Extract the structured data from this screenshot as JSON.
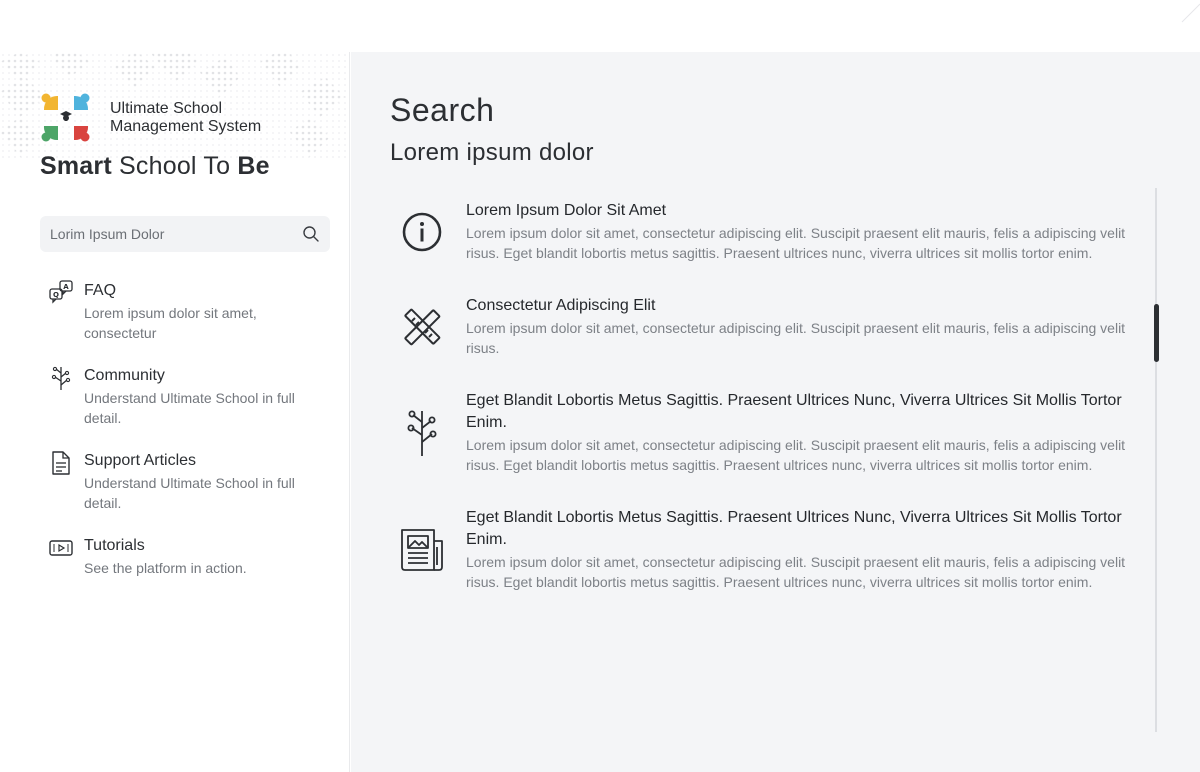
{
  "brand": {
    "name_line1": "Ultimate School",
    "name_line2": "Management System",
    "tagline_bold1": "Smart",
    "tagline_light": "School To",
    "tagline_bold2": "Be"
  },
  "sidebar": {
    "search": {
      "placeholder": "Lorim Ipsum Dolor"
    },
    "items": [
      {
        "title": "FAQ",
        "desc": "Lorem ipsum dolor sit amet, consectetur",
        "icon": "faq-icon"
      },
      {
        "title": "Community",
        "desc": "Understand Ultimate School in full detail.",
        "icon": "community-icon"
      },
      {
        "title": "Support Articles",
        "desc": "Understand Ultimate School in full detail.",
        "icon": "document-icon"
      },
      {
        "title": "Tutorials",
        "desc": "See the platform in action.",
        "icon": "video-icon"
      }
    ]
  },
  "main": {
    "title": "Search",
    "subtitle": "Lorem ipsum dolor",
    "results": [
      {
        "title": "Lorem Ipsum Dolor Sit Amet",
        "desc": "Lorem ipsum dolor sit amet, consectetur adipiscing elit. Suscipit praesent elit mauris, felis a adipiscing velit risus. Eget blandit lobortis metus sagittis. Praesent ultrices nunc, viverra ultrices sit mollis tortor enim.",
        "icon": "info-icon"
      },
      {
        "title": "Consectetur Adipiscing Elit",
        "desc": "Lorem ipsum dolor sit amet, consectetur adipiscing elit. Suscipit praesent elit mauris, felis a adipiscing velit risus.",
        "icon": "design-tools-icon"
      },
      {
        "title": "Eget Blandit Lobortis Metus Sagittis. Praesent Ultrices Nunc, Viverra Ultrices Sit Mollis Tortor Enim.",
        "desc": "Lorem ipsum dolor sit amet, consectetur adipiscing elit. Suscipit praesent elit mauris, felis a adipiscing velit risus. Eget blandit lobortis metus sagittis. Praesent ultrices nunc, viverra ultrices sit mollis tortor enim.",
        "icon": "community-icon"
      },
      {
        "title": "Eget Blandit Lobortis Metus Sagittis. Praesent Ultrices Nunc, Viverra Ultrices Sit Mollis Tortor Enim.",
        "desc": "Lorem ipsum dolor sit amet, consectetur adipiscing elit. Suscipit praesent elit mauris, felis a adipiscing velit risus. Eget blandit lobortis metus sagittis. Praesent ultrices nunc, viverra ultrices sit mollis tortor enim.",
        "icon": "newspaper-icon"
      }
    ]
  },
  "colors": {
    "text": "#2c2f33",
    "muted": "#73777d",
    "panel": "#f4f5f7",
    "logo_yellow": "#f2b531",
    "logo_blue": "#4fb3dd",
    "logo_green": "#4da568",
    "logo_red": "#d9443f"
  }
}
